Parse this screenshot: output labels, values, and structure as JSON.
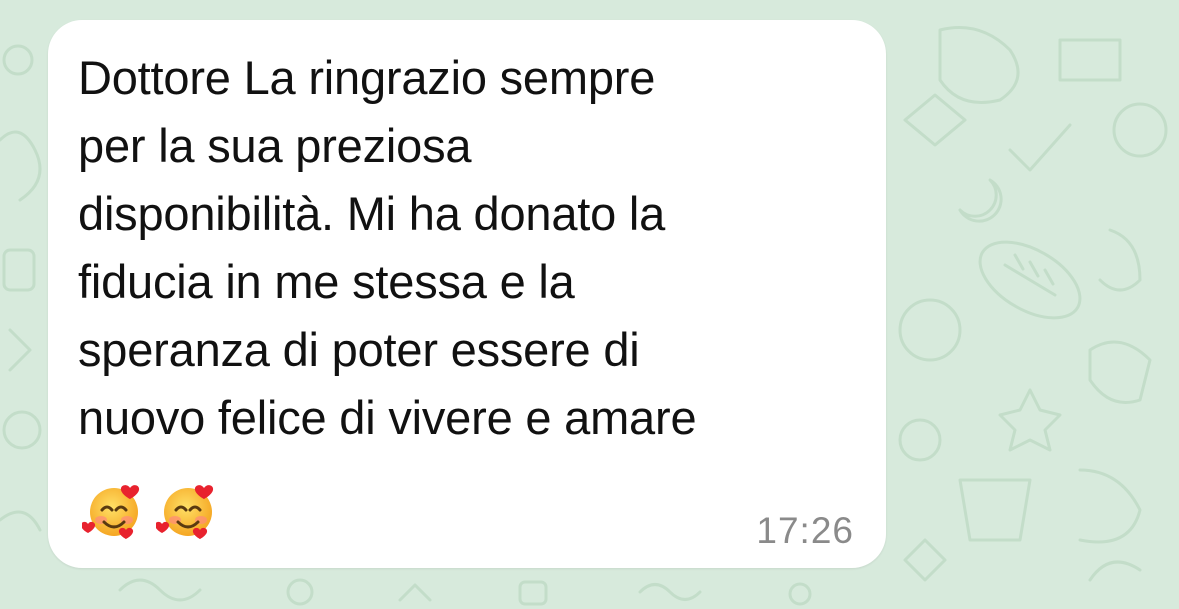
{
  "chat": {
    "background_color": "#d7eadc",
    "bubble_color": "#ffffff",
    "message": {
      "lines": [
        "Dottore La ringrazio sempre",
        "per la sua preziosa",
        "disponibilità. Mi ha donato la",
        "fiducia in me stessa e la",
        "speranza di poter essere di",
        "nuovo felice di vivere e amare"
      ],
      "emojis": [
        "smiling-face-with-hearts-icon",
        "smiling-face-with-hearts-icon"
      ],
      "time": "17:26"
    }
  }
}
